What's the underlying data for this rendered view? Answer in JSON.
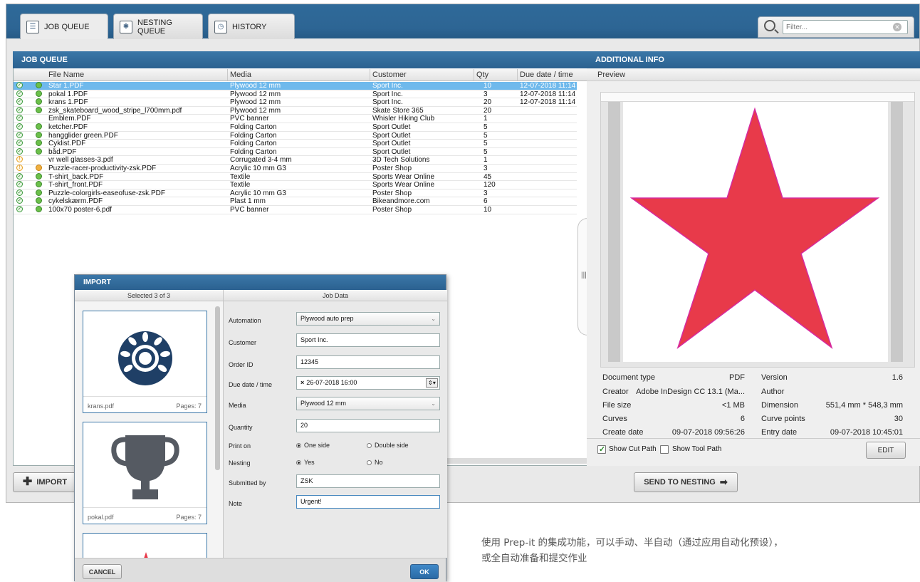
{
  "tabs": [
    {
      "label": "JOB QUEUE",
      "icon": "list-icon"
    },
    {
      "label": "NESTING QUEUE",
      "icon": "puzzle-icon"
    },
    {
      "label": "HISTORY",
      "icon": "clock-icon"
    }
  ],
  "filter": {
    "placeholder": "Filter..."
  },
  "job_queue": {
    "title": "JOB QUEUE",
    "columns": [
      "File Name",
      "Media",
      "Customer",
      "Qty",
      "Due date / time"
    ],
    "rows": [
      {
        "file": "Star 1.PDF",
        "media": "Plywood 12 mm",
        "customer": "Sport Inc.",
        "qty": "10",
        "due": "12-07-2018 11:14",
        "status": "ok",
        "nest": "green",
        "selected": true
      },
      {
        "file": "pokal 1.PDF",
        "media": "Plywood 12 mm",
        "customer": "Sport Inc.",
        "qty": "3",
        "due": "12-07-2018 11:14",
        "status": "ok",
        "nest": "green"
      },
      {
        "file": "krans 1.PDF",
        "media": "Plywood 12 mm",
        "customer": "Sport Inc.",
        "qty": "20",
        "due": "12-07-2018 11:14",
        "status": "ok",
        "nest": "green"
      },
      {
        "file": "zsk_skateboard_wood_stripe_l700mm.pdf",
        "media": "Plywood 12 mm",
        "customer": "Skate Store 365",
        "qty": "20",
        "due": "",
        "status": "ok",
        "nest": "green"
      },
      {
        "file": "Emblem.PDF",
        "media": "PVC banner",
        "customer": "Whisler Hiking Club",
        "qty": "1",
        "due": "",
        "status": "ok",
        "nest": ""
      },
      {
        "file": "ketcher.PDF",
        "media": "Folding Carton",
        "customer": "Sport Outlet",
        "qty": "5",
        "due": "",
        "status": "ok",
        "nest": "green"
      },
      {
        "file": "hangglider green.PDF",
        "media": "Folding Carton",
        "customer": "Sport Outlet",
        "qty": "5",
        "due": "",
        "status": "ok",
        "nest": "green"
      },
      {
        "file": "Cyklist.PDF",
        "media": "Folding Carton",
        "customer": "Sport Outlet",
        "qty": "5",
        "due": "",
        "status": "ok",
        "nest": "green"
      },
      {
        "file": "båd.PDF",
        "media": "Folding Carton",
        "customer": "Sport Outlet",
        "qty": "5",
        "due": "",
        "status": "ok",
        "nest": "green"
      },
      {
        "file": "vr well glasses-3.pdf",
        "media": "Corrugated 3-4 mm",
        "customer": "3D Tech Solutions",
        "qty": "1",
        "due": "",
        "status": "warn",
        "nest": ""
      },
      {
        "file": "Puzzle-racer-productivity-zsk.PDF",
        "media": "Acrylic 10 mm G3",
        "customer": "Poster Shop",
        "qty": "3",
        "due": "",
        "status": "warn",
        "nest": "orange"
      },
      {
        "file": "T-shirt_back.PDF",
        "media": "Textile",
        "customer": "Sports Wear Online",
        "qty": "45",
        "due": "",
        "status": "ok",
        "nest": "green"
      },
      {
        "file": "T-shirt_front.PDF",
        "media": "Textile",
        "customer": "Sports Wear Online",
        "qty": "120",
        "due": "",
        "status": "ok",
        "nest": "green"
      },
      {
        "file": "Puzzle-colorgirls-easeofuse-zsk.PDF",
        "media": "Acrylic 10 mm G3",
        "customer": "Poster Shop",
        "qty": "3",
        "due": "",
        "status": "ok",
        "nest": "green"
      },
      {
        "file": "cykelskærm.PDF",
        "media": "Plast 1 mm",
        "customer": "Bikeandmore.com",
        "qty": "6",
        "due": "",
        "status": "ok",
        "nest": "green"
      },
      {
        "file": "100x70 poster-6.pdf",
        "media": "PVC banner",
        "customer": "Poster Shop",
        "qty": "10",
        "due": "",
        "status": "ok",
        "nest": "green"
      }
    ]
  },
  "import_button": "IMPORT",
  "send_button": "SEND TO NESTING",
  "additional_info": {
    "title": "ADDITIONAL INFO",
    "preview_label": "Preview",
    "star_color": "#e83a4a",
    "star_stroke": "#d62aa0",
    "meta_left": [
      {
        "label": "Document type",
        "value": "PDF"
      },
      {
        "label": "Creator",
        "value": "Adobe InDesign CC 13.1 (Ma..."
      },
      {
        "label": "File size",
        "value": "<1 MB"
      },
      {
        "label": "Curves",
        "value": "6"
      },
      {
        "label": "Create date",
        "value": "09-07-2018 09:56:26"
      }
    ],
    "meta_right": [
      {
        "label": "Version",
        "value": "1.6"
      },
      {
        "label": "Author",
        "value": ""
      },
      {
        "label": "Dimension",
        "value": "551,4 mm * 548,3 mm"
      },
      {
        "label": "Curve points",
        "value": "30"
      },
      {
        "label": "Entry date",
        "value": "09-07-2018 10:45:01"
      }
    ],
    "show_cut_path": "Show Cut Path",
    "show_tool_path": "Show Tool Path",
    "edit": "EDIT"
  },
  "import_dialog": {
    "title": "IMPORT",
    "selected": "Selected 3 of 3",
    "job_data": "Job Data",
    "cards": [
      {
        "name": "krans.pdf",
        "pages": "Pages: 7"
      },
      {
        "name": "pokal.pdf",
        "pages": "Pages: 7"
      }
    ],
    "fields": {
      "automation_label": "Automation",
      "automation": "Plywood auto prep",
      "customer_label": "Customer",
      "customer": "Sport Inc.",
      "order_label": "Order ID",
      "order": "12345",
      "due_label": "Due date / time",
      "due": "26-07-2018 16:00",
      "media_label": "Media",
      "media": "Plywood 12 mm",
      "quantity_label": "Quantity",
      "quantity": "20",
      "print_label": "Print on",
      "print_one": "One side",
      "print_double": "Double side",
      "nesting_label": "Nesting",
      "nesting_yes": "Yes",
      "nesting_no": "No",
      "submitted_label": "Submitted by",
      "submitted": "ZSK",
      "note_label": "Note",
      "note": "Urgent!"
    },
    "cancel": "CANCEL",
    "ok": "OK"
  },
  "caption_lines": [
    "使用 Prep-it 的集成功能，可以手动、半自动（通过应用自动化预设），",
    "或全自动准备和提交作业"
  ]
}
